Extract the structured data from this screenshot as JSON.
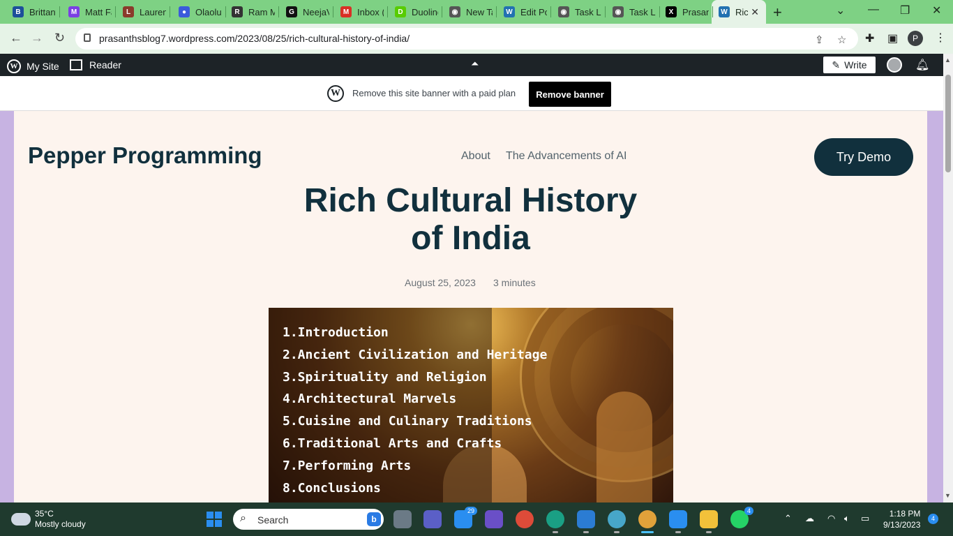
{
  "browser": {
    "tabs": [
      {
        "title": "Brittany",
        "icon": "b-icon",
        "color": "#1d4f9a",
        "glyph": "B"
      },
      {
        "title": "Matt Fa",
        "icon": "analytics-icon",
        "color": "#7b3fe4",
        "glyph": "M"
      },
      {
        "title": "Lauren",
        "icon": "avatar-icon",
        "color": "#8a3b2b",
        "glyph": "L"
      },
      {
        "title": "Olaolu",
        "icon": "map-pin-icon",
        "color": "#3b5bdb",
        "glyph": "●"
      },
      {
        "title": "Ram M",
        "icon": "photo-icon",
        "color": "#333333",
        "glyph": "R"
      },
      {
        "title": "NeejaV",
        "icon": "github-icon",
        "color": "#111111",
        "glyph": "G"
      },
      {
        "title": "Inbox (",
        "icon": "gmail-icon",
        "color": "#d93025",
        "glyph": "M"
      },
      {
        "title": "Duoling",
        "icon": "duolingo-icon",
        "color": "#58cc02",
        "glyph": "D"
      },
      {
        "title": "New Ta",
        "icon": "chrome-icon",
        "color": "#555555",
        "glyph": "◉"
      },
      {
        "title": "Edit Po",
        "icon": "wordpress-icon",
        "color": "#2271b1",
        "glyph": "W"
      },
      {
        "title": "Task Li",
        "icon": "chrome-icon",
        "color": "#555555",
        "glyph": "◉"
      },
      {
        "title": "Task Li",
        "icon": "chrome-icon",
        "color": "#555555",
        "glyph": "◉"
      },
      {
        "title": "Prasan",
        "icon": "x-icon",
        "color": "#000000",
        "glyph": "X"
      },
      {
        "title": "Ric",
        "icon": "wordpress-icon",
        "color": "#2271b1",
        "glyph": "W",
        "active": true
      }
    ],
    "url": "prasanthsblog7.wordpress.com/2023/08/25/rich-cultural-history-of-india/",
    "profile_initial": "P"
  },
  "wp_admin_bar": {
    "my_site": "My Site",
    "reader": "Reader",
    "write": "Write"
  },
  "banner": {
    "message": "Remove this site banner with a paid plan",
    "button": "Remove banner"
  },
  "site": {
    "title": "Pepper Programming",
    "nav": [
      "About",
      "The Advancements of AI"
    ],
    "cta": "Try Demo"
  },
  "post": {
    "title_line1": "Rich Cultural History",
    "title_line2": "of India",
    "date": "August 25, 2023",
    "read_time": "3 minutes",
    "toc": [
      "1.Introduction",
      "2.Ancient Civilization and Heritage",
      "3.Spirituality and Religion",
      "4.Architectural Marvels",
      "5.Cuisine and Culinary Traditions",
      "6.Traditional Arts and Crafts",
      "7.Performing Arts",
      "8.Conclusions"
    ]
  },
  "taskbar": {
    "temperature": "35°C",
    "condition": "Mostly cloudy",
    "search_placeholder": "Search",
    "mail_badge": "29",
    "whatsapp_badge": "4",
    "time": "1:18 PM",
    "date": "9/13/2023",
    "notification_count": "4"
  },
  "colors": {
    "tab_strip": "#7ed184",
    "page_bg": "#fdf4ee",
    "brand_dark": "#11303d",
    "side_bg": "#c7b3e2"
  }
}
